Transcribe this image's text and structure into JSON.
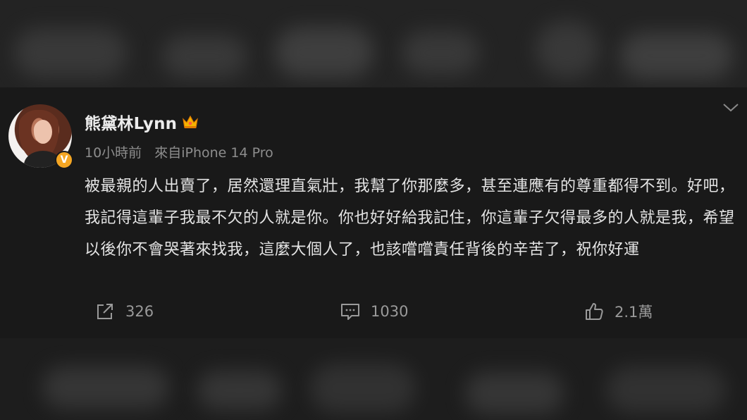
{
  "post": {
    "username": "熊黛林Lynn",
    "time": "10小時前",
    "source": "來自iPhone 14 Pro",
    "content": "被最親的人出賣了，居然還理直氣壯，我幫了你那麼多，甚至連應有的尊重都得不到。好吧，我記得這輩子我最不欠的人就是你。你也好好給我記住，你這輩子欠得最多的人就是我，希望以後你不會哭著來找我，這麼大個人了，也該嚐嚐責任背後的辛苦了，祝你好運",
    "verified_mark": "V"
  },
  "actions": {
    "repost_count": "326",
    "comment_count": "1030",
    "like_count": "2.1萬"
  },
  "icons": {
    "crown": "crown-icon",
    "chevron": "chevron-down-icon",
    "repost": "share-icon",
    "comment": "comment-icon",
    "like": "thumbs-up-icon"
  },
  "colors": {
    "background": "#191919",
    "text": "#e4e4e4",
    "muted": "#8d8d8d",
    "verified": "#f5a623"
  }
}
